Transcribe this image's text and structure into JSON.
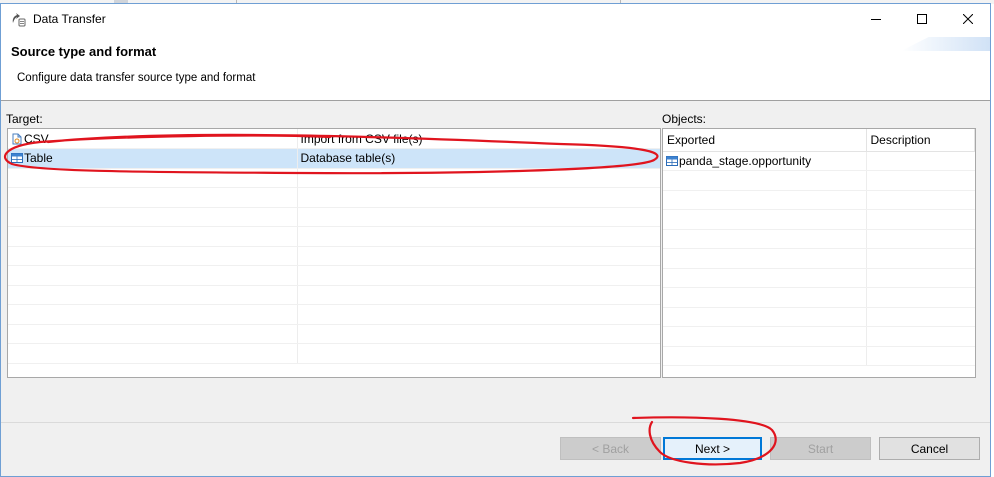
{
  "window": {
    "title": "Data Transfer",
    "icon": "data-transfer-icon"
  },
  "header": {
    "title": "Source type and format",
    "subtitle": "Configure data transfer source type and format"
  },
  "target": {
    "label": "Target:",
    "rows": [
      {
        "icon": "csv-file-icon",
        "name": "CSV",
        "description": "Import from CSV file(s)",
        "selected": false
      },
      {
        "icon": "table-icon",
        "name": "Table",
        "description": "Database table(s)",
        "selected": true
      }
    ]
  },
  "objects": {
    "label": "Objects:",
    "columns": [
      "Exported",
      "Description"
    ],
    "rows": [
      {
        "icon": "table-icon",
        "name": "panda_stage.opportunity",
        "description": ""
      }
    ]
  },
  "buttons": {
    "back": "< Back",
    "next": "Next >",
    "start": "Start",
    "cancel": "Cancel"
  },
  "colors": {
    "selection": "#cde4f9",
    "annotation": "#e0141e",
    "default_button_border": "#0078d7",
    "window_border": "#6f9fd4"
  }
}
